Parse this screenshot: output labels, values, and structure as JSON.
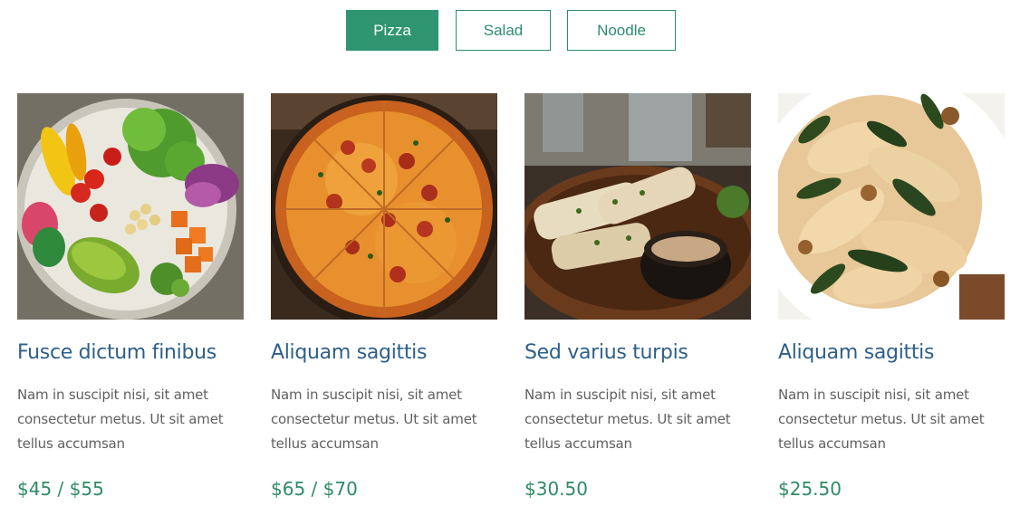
{
  "tabs": [
    {
      "label": "Pizza",
      "active": true
    },
    {
      "label": "Salad",
      "active": false
    },
    {
      "label": "Noodle",
      "active": false
    }
  ],
  "colors": {
    "accent": "#2e9570",
    "title": "#2e5f8a",
    "price": "#2e8b62",
    "text": "#606060"
  },
  "items": [
    {
      "title": "Fusce dictum finibus",
      "desc": "Nam in suscipit nisi, sit amet consectetur metus. Ut sit amet tellus accumsan",
      "price": "$45 / $55",
      "image": "salad-bowl-photo"
    },
    {
      "title": "Aliquam sagittis",
      "desc": "Nam in suscipit nisi, sit amet consectetur metus. Ut sit amet tellus accumsan",
      "price": "$65 / $70",
      "image": "pizza-photo"
    },
    {
      "title": "Sed varius turpis",
      "desc": "Nam in suscipit nisi, sit amet consectetur metus. Ut sit amet tellus accumsan",
      "price": "$30.50",
      "image": "grilled-squid-photo"
    },
    {
      "title": "Aliquam sagittis",
      "desc": "Nam in suscipit nisi, sit amet consectetur metus. Ut sit amet tellus accumsan",
      "price": "$25.50",
      "image": "pasta-photo"
    }
  ]
}
